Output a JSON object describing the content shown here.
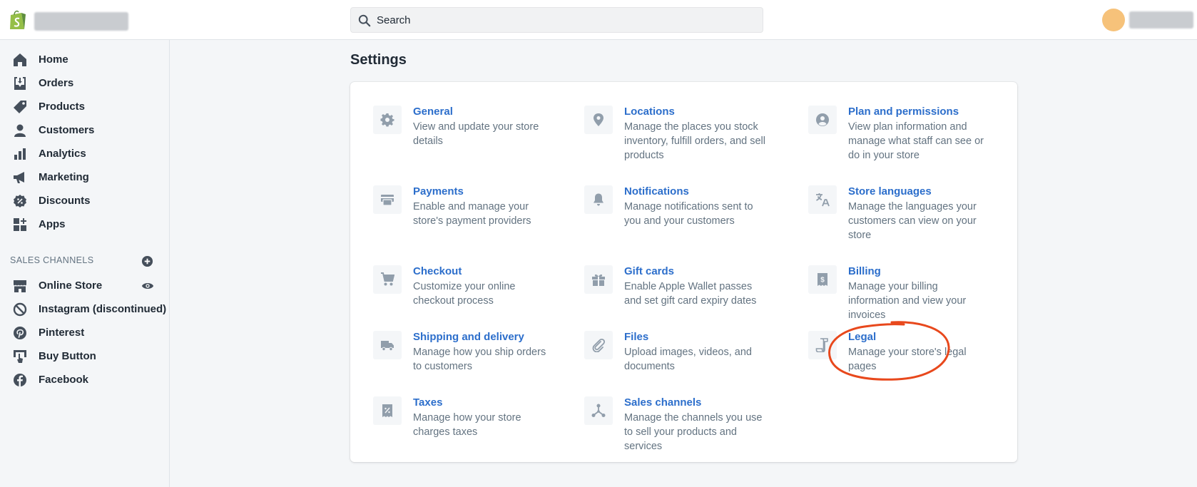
{
  "header": {
    "search_placeholder": "Search"
  },
  "sidebar": {
    "items": [
      {
        "label": "Home",
        "icon": "home-icon"
      },
      {
        "label": "Orders",
        "icon": "orders-icon"
      },
      {
        "label": "Products",
        "icon": "tag-icon"
      },
      {
        "label": "Customers",
        "icon": "person-icon"
      },
      {
        "label": "Analytics",
        "icon": "bar-chart-icon"
      },
      {
        "label": "Marketing",
        "icon": "megaphone-icon"
      },
      {
        "label": "Discounts",
        "icon": "discount-icon"
      },
      {
        "label": "Apps",
        "icon": "apps-icon"
      }
    ],
    "sales_channels_header": "SALES CHANNELS",
    "channels": [
      {
        "label": "Online Store",
        "icon": "store-icon"
      },
      {
        "label": "Instagram (discontinued)",
        "icon": "blocked-icon"
      },
      {
        "label": "Pinterest",
        "icon": "pinterest-icon"
      },
      {
        "label": "Buy Button",
        "icon": "buy-button-icon"
      },
      {
        "label": "Facebook",
        "icon": "facebook-icon"
      }
    ]
  },
  "main": {
    "title": "Settings",
    "settings": [
      {
        "title": "General",
        "desc": "View and update your store details",
        "icon": "gear-icon"
      },
      {
        "title": "Locations",
        "desc": "Manage the places you stock inventory, fulfill orders, and sell products",
        "icon": "location-pin-icon"
      },
      {
        "title": "Plan and permissions",
        "desc": "View plan information and manage what staff can see or do in your store",
        "icon": "user-circle-icon"
      },
      {
        "title": "Payments",
        "desc": "Enable and manage your store's payment providers",
        "icon": "payments-icon"
      },
      {
        "title": "Notifications",
        "desc": "Manage notifications sent to you and your customers",
        "icon": "bell-icon"
      },
      {
        "title": "Store languages",
        "desc": "Manage the languages your customers can view on your store",
        "icon": "translate-icon"
      },
      {
        "title": "Checkout",
        "desc": "Customize your online checkout process",
        "icon": "cart-icon"
      },
      {
        "title": "Gift cards",
        "desc": "Enable Apple Wallet passes and set gift card expiry dates",
        "icon": "gift-icon"
      },
      {
        "title": "Billing",
        "desc": "Manage your billing information and view your invoices",
        "icon": "billing-icon"
      },
      {
        "title": "Shipping and delivery",
        "desc": "Manage how you ship orders to customers",
        "icon": "truck-icon"
      },
      {
        "title": "Files",
        "desc": "Upload images, videos, and documents",
        "icon": "paperclip-icon"
      },
      {
        "title": "Legal",
        "desc": "Manage your store's legal pages",
        "icon": "legal-icon"
      },
      {
        "title": "Taxes",
        "desc": "Manage how your store charges taxes",
        "icon": "tax-icon"
      },
      {
        "title": "Sales channels",
        "desc": "Manage the channels you use to sell your products and services",
        "icon": "channels-icon"
      }
    ]
  },
  "colors": {
    "link": "#2c6ecb",
    "annotation": "#e8481c",
    "avatar": "#f6c27a",
    "logo": "#95bf47"
  }
}
